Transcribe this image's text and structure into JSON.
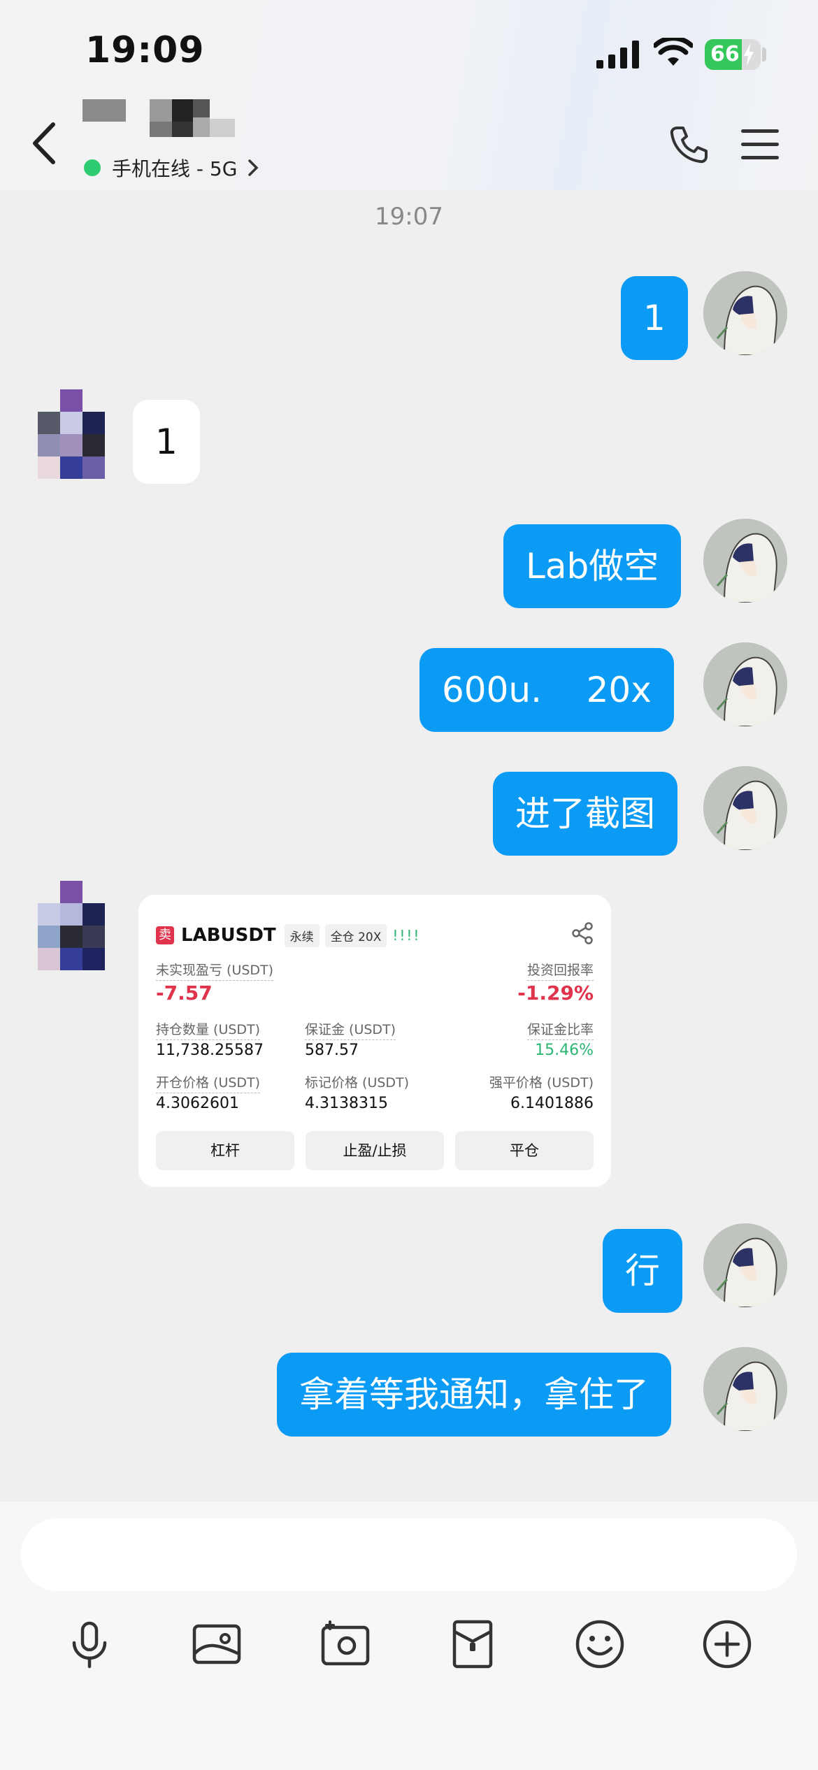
{
  "status_bar": {
    "time": "19:09",
    "battery": "66",
    "battery_level": 0.66
  },
  "header": {
    "contact_name": "",
    "online_status": "手机在线 - 5G"
  },
  "colors": {
    "accent": "#0b9bf5",
    "online": "#2ecc71",
    "loss": "#e0334c",
    "gain": "#2bb673"
  },
  "chat": {
    "timestamp": "19:07",
    "messages": [
      {
        "side": "out",
        "text": "1"
      },
      {
        "side": "in",
        "text": "1"
      },
      {
        "side": "out",
        "text": "Lab做空"
      },
      {
        "side": "out",
        "text": "600u.    20x"
      },
      {
        "side": "out",
        "text": "进了截图"
      },
      {
        "side": "in",
        "type": "trade_card"
      },
      {
        "side": "out",
        "text": "行"
      },
      {
        "side": "out",
        "text": "拿着等我通知，拿住了"
      }
    ]
  },
  "trade_card": {
    "sell_badge": "卖",
    "symbol": "LABUSDT",
    "tag_type": "永续",
    "tag_margin": "全仓 20X",
    "signal_bars": "!!!!",
    "unrealized_pnl_label": "未实现盈亏 (USDT)",
    "unrealized_pnl": "-7.57",
    "roi_label": "投资回报率",
    "roi": "-1.29%",
    "position_qty_label": "持仓数量 (USDT)",
    "position_qty": "11,738.25587",
    "margin_label": "保证金 (USDT)",
    "margin": "587.57",
    "margin_ratio_label": "保证金比率",
    "margin_ratio": "15.46%",
    "entry_price_label": "开仓价格 (USDT)",
    "entry_price": "4.3062601",
    "mark_price_label": "标记价格 (USDT)",
    "mark_price": "4.3138315",
    "liq_price_label": "强平价格 (USDT)",
    "liq_price": "6.1401886",
    "btn_leverage": "杠杆",
    "btn_tpsl": "止盈/止损",
    "btn_close": "平仓"
  },
  "input": {
    "placeholder": ""
  },
  "toolbar_icons": [
    "microphone-icon",
    "image-icon",
    "camera-icon",
    "red-packet-icon",
    "emoji-icon",
    "plus-icon"
  ]
}
